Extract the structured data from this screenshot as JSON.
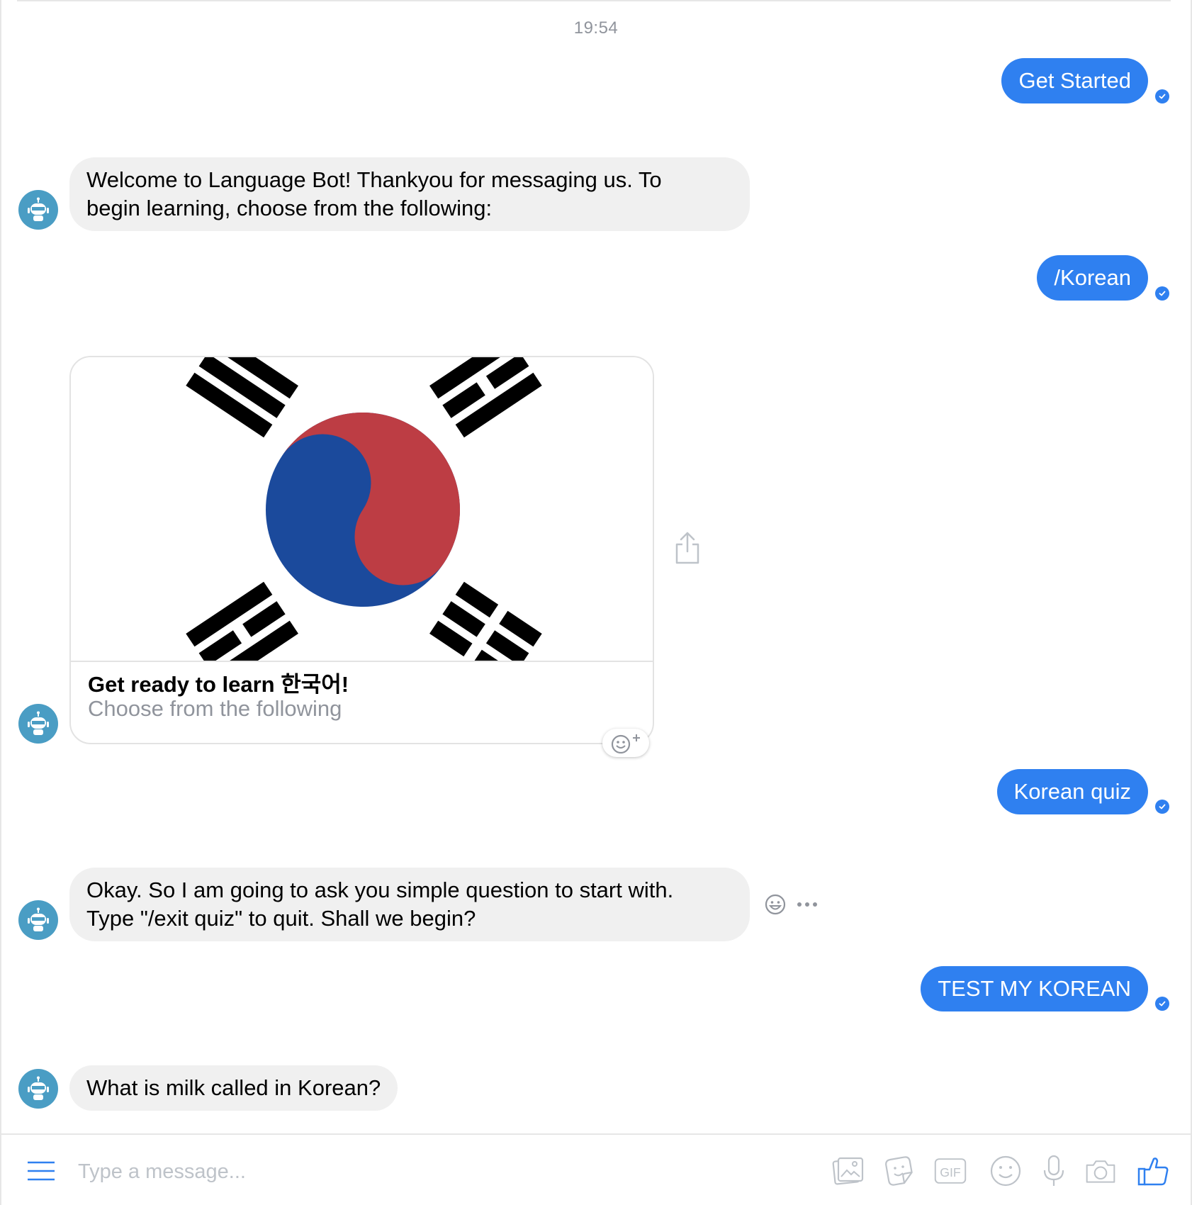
{
  "conversation": {
    "timestamp": "19:54",
    "messages": [
      {
        "from": "user",
        "text": "Get Started"
      },
      {
        "from": "bot",
        "lines": [
          "Welcome to Language Bot! Thankyou for messaging us. To",
          "begin learning, choose from the following:"
        ]
      },
      {
        "from": "user",
        "text": "/Korean"
      },
      {
        "from": "bot",
        "type": "card",
        "title": "Get ready to learn 한국어!",
        "subtitle": "Choose from the following",
        "image": "south-korea-flag"
      },
      {
        "from": "user",
        "text": "Korean quiz"
      },
      {
        "from": "bot",
        "lines": [
          "Okay. So I am going to ask you simple question to start with.",
          "Type \"/exit quiz\" to quit. Shall we begin?"
        ]
      },
      {
        "from": "user",
        "text": "TEST MY KOREAN"
      },
      {
        "from": "bot",
        "text": "What is milk called in Korean?"
      }
    ]
  },
  "composer": {
    "placeholder": "Type a message...",
    "value": "",
    "icons": [
      "menu-icon",
      "photo-icon",
      "sticker-icon",
      "gif-icon",
      "emoji-icon",
      "microphone-icon",
      "camera-icon",
      "thumbs-up-icon"
    ]
  },
  "colors": {
    "accent": "#2f80f0",
    "incoming_bubble": "#f0f0f0",
    "avatar": "#4a9dc4",
    "flag_red": "#bd3d44",
    "flag_blue": "#1b4a9c"
  }
}
